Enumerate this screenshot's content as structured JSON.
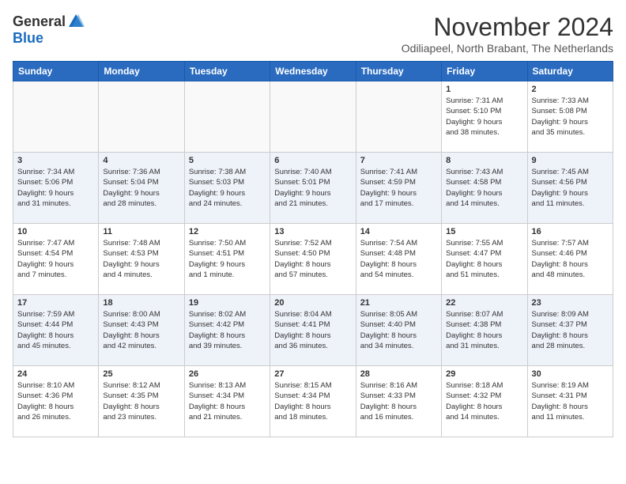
{
  "header": {
    "logo_general": "General",
    "logo_blue": "Blue",
    "month_title": "November 2024",
    "subtitle": "Odiliapeel, North Brabant, The Netherlands"
  },
  "weekdays": [
    "Sunday",
    "Monday",
    "Tuesday",
    "Wednesday",
    "Thursday",
    "Friday",
    "Saturday"
  ],
  "weeks": [
    [
      {
        "day": "",
        "info": ""
      },
      {
        "day": "",
        "info": ""
      },
      {
        "day": "",
        "info": ""
      },
      {
        "day": "",
        "info": ""
      },
      {
        "day": "",
        "info": ""
      },
      {
        "day": "1",
        "info": "Sunrise: 7:31 AM\nSunset: 5:10 PM\nDaylight: 9 hours\nand 38 minutes."
      },
      {
        "day": "2",
        "info": "Sunrise: 7:33 AM\nSunset: 5:08 PM\nDaylight: 9 hours\nand 35 minutes."
      }
    ],
    [
      {
        "day": "3",
        "info": "Sunrise: 7:34 AM\nSunset: 5:06 PM\nDaylight: 9 hours\nand 31 minutes."
      },
      {
        "day": "4",
        "info": "Sunrise: 7:36 AM\nSunset: 5:04 PM\nDaylight: 9 hours\nand 28 minutes."
      },
      {
        "day": "5",
        "info": "Sunrise: 7:38 AM\nSunset: 5:03 PM\nDaylight: 9 hours\nand 24 minutes."
      },
      {
        "day": "6",
        "info": "Sunrise: 7:40 AM\nSunset: 5:01 PM\nDaylight: 9 hours\nand 21 minutes."
      },
      {
        "day": "7",
        "info": "Sunrise: 7:41 AM\nSunset: 4:59 PM\nDaylight: 9 hours\nand 17 minutes."
      },
      {
        "day": "8",
        "info": "Sunrise: 7:43 AM\nSunset: 4:58 PM\nDaylight: 9 hours\nand 14 minutes."
      },
      {
        "day": "9",
        "info": "Sunrise: 7:45 AM\nSunset: 4:56 PM\nDaylight: 9 hours\nand 11 minutes."
      }
    ],
    [
      {
        "day": "10",
        "info": "Sunrise: 7:47 AM\nSunset: 4:54 PM\nDaylight: 9 hours\nand 7 minutes."
      },
      {
        "day": "11",
        "info": "Sunrise: 7:48 AM\nSunset: 4:53 PM\nDaylight: 9 hours\nand 4 minutes."
      },
      {
        "day": "12",
        "info": "Sunrise: 7:50 AM\nSunset: 4:51 PM\nDaylight: 9 hours\nand 1 minute."
      },
      {
        "day": "13",
        "info": "Sunrise: 7:52 AM\nSunset: 4:50 PM\nDaylight: 8 hours\nand 57 minutes."
      },
      {
        "day": "14",
        "info": "Sunrise: 7:54 AM\nSunset: 4:48 PM\nDaylight: 8 hours\nand 54 minutes."
      },
      {
        "day": "15",
        "info": "Sunrise: 7:55 AM\nSunset: 4:47 PM\nDaylight: 8 hours\nand 51 minutes."
      },
      {
        "day": "16",
        "info": "Sunrise: 7:57 AM\nSunset: 4:46 PM\nDaylight: 8 hours\nand 48 minutes."
      }
    ],
    [
      {
        "day": "17",
        "info": "Sunrise: 7:59 AM\nSunset: 4:44 PM\nDaylight: 8 hours\nand 45 minutes."
      },
      {
        "day": "18",
        "info": "Sunrise: 8:00 AM\nSunset: 4:43 PM\nDaylight: 8 hours\nand 42 minutes."
      },
      {
        "day": "19",
        "info": "Sunrise: 8:02 AM\nSunset: 4:42 PM\nDaylight: 8 hours\nand 39 minutes."
      },
      {
        "day": "20",
        "info": "Sunrise: 8:04 AM\nSunset: 4:41 PM\nDaylight: 8 hours\nand 36 minutes."
      },
      {
        "day": "21",
        "info": "Sunrise: 8:05 AM\nSunset: 4:40 PM\nDaylight: 8 hours\nand 34 minutes."
      },
      {
        "day": "22",
        "info": "Sunrise: 8:07 AM\nSunset: 4:38 PM\nDaylight: 8 hours\nand 31 minutes."
      },
      {
        "day": "23",
        "info": "Sunrise: 8:09 AM\nSunset: 4:37 PM\nDaylight: 8 hours\nand 28 minutes."
      }
    ],
    [
      {
        "day": "24",
        "info": "Sunrise: 8:10 AM\nSunset: 4:36 PM\nDaylight: 8 hours\nand 26 minutes."
      },
      {
        "day": "25",
        "info": "Sunrise: 8:12 AM\nSunset: 4:35 PM\nDaylight: 8 hours\nand 23 minutes."
      },
      {
        "day": "26",
        "info": "Sunrise: 8:13 AM\nSunset: 4:34 PM\nDaylight: 8 hours\nand 21 minutes."
      },
      {
        "day": "27",
        "info": "Sunrise: 8:15 AM\nSunset: 4:34 PM\nDaylight: 8 hours\nand 18 minutes."
      },
      {
        "day": "28",
        "info": "Sunrise: 8:16 AM\nSunset: 4:33 PM\nDaylight: 8 hours\nand 16 minutes."
      },
      {
        "day": "29",
        "info": "Sunrise: 8:18 AM\nSunset: 4:32 PM\nDaylight: 8 hours\nand 14 minutes."
      },
      {
        "day": "30",
        "info": "Sunrise: 8:19 AM\nSunset: 4:31 PM\nDaylight: 8 hours\nand 11 minutes."
      }
    ]
  ]
}
